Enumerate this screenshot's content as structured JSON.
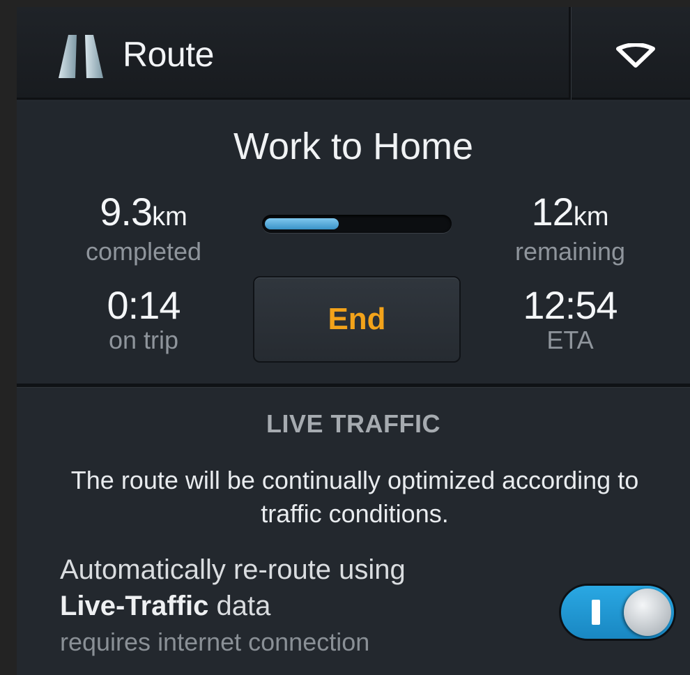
{
  "header": {
    "title": "Route",
    "icon": "road-icon",
    "menu_icon": "chevron-down-icon"
  },
  "trip": {
    "title": "Work to Home",
    "completed": {
      "value": "9.3",
      "unit": "km",
      "label": "completed"
    },
    "remaining": {
      "value": "12",
      "unit": "km",
      "label": "remaining"
    },
    "on_trip": {
      "value": "0:14",
      "label": "on trip"
    },
    "eta": {
      "value": "12:54",
      "label": "ETA"
    },
    "progress_fraction": 0.4,
    "end_label": "End"
  },
  "traffic": {
    "heading": "LIVE TRAFFIC",
    "description": "The route will be continually optimized according to traffic conditions.",
    "reroute_line1": "Automatically re-route using",
    "reroute_bold": "Live-Traffic",
    "reroute_rest": " data",
    "requirement": "requires internet connection",
    "toggle_on": true,
    "toggle_glyph": "I"
  },
  "colors": {
    "accent_blue": "#2aa8e3",
    "end_orange": "#f3a31a",
    "panel_bg": "#23282e"
  }
}
